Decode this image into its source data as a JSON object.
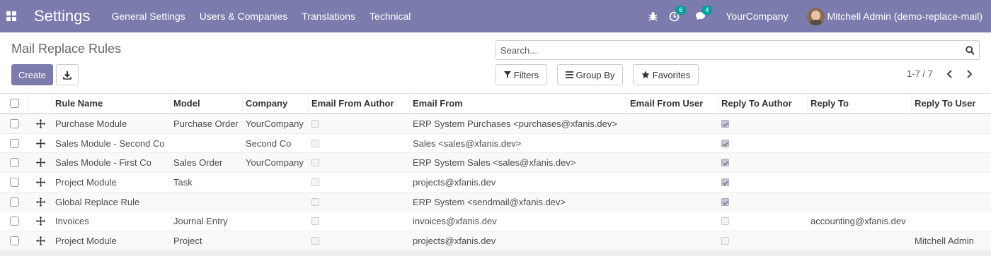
{
  "navbar": {
    "app_name": "Settings",
    "menu": [
      "General Settings",
      "Users & Companies",
      "Translations",
      "Technical"
    ],
    "activity_badge": "6",
    "messages_badge": "4",
    "company": "YourCompany",
    "user": "Mitchell Admin (demo-replace-mail)"
  },
  "control_panel": {
    "title": "Mail Replace Rules",
    "create_label": "Create",
    "search_placeholder": "Search...",
    "filters_label": "Filters",
    "group_by_label": "Group By",
    "favorites_label": "Favorites",
    "pager": "1-7 / 7"
  },
  "table": {
    "columns": [
      "Rule Name",
      "Model",
      "Company",
      "Email From Author",
      "Email From",
      "Email From User",
      "Reply To Author",
      "Reply To",
      "Reply To User"
    ],
    "rows": [
      {
        "name": "Purchase Module",
        "model": "Purchase Order",
        "company": "YourCompany",
        "email_from_author": false,
        "email_from": "ERP System Purchases <purchases@xfanis.dev>",
        "email_from_user": "",
        "reply_to_author": true,
        "reply_to": "",
        "reply_to_user": ""
      },
      {
        "name": "Sales Module - Second Co",
        "model": "",
        "company": "Second Co",
        "email_from_author": false,
        "email_from": "Sales <sales@xfanis.dev>",
        "email_from_user": "",
        "reply_to_author": true,
        "reply_to": "",
        "reply_to_user": ""
      },
      {
        "name": "Sales Module - First Co",
        "model": "Sales Order",
        "company": "YourCompany",
        "email_from_author": false,
        "email_from": "ERP System Sales <sales@xfanis.dev>",
        "email_from_user": "",
        "reply_to_author": true,
        "reply_to": "",
        "reply_to_user": ""
      },
      {
        "name": "Project Module",
        "model": "Task",
        "company": "",
        "email_from_author": false,
        "email_from": "projects@xfanis.dev",
        "email_from_user": "",
        "reply_to_author": true,
        "reply_to": "",
        "reply_to_user": ""
      },
      {
        "name": "Global Replace Rule",
        "model": "",
        "company": "",
        "email_from_author": false,
        "email_from": "ERP System <sendmail@xfanis.dev>",
        "email_from_user": "",
        "reply_to_author": true,
        "reply_to": "",
        "reply_to_user": ""
      },
      {
        "name": "Invoices",
        "model": "Journal Entry",
        "company": "",
        "email_from_author": false,
        "email_from": "invoices@xfanis.dev",
        "email_from_user": "",
        "reply_to_author": false,
        "reply_to": "accounting@xfanis.dev",
        "reply_to_user": ""
      },
      {
        "name": "Project Module",
        "model": "Project",
        "company": "",
        "email_from_author": false,
        "email_from": "projects@xfanis.dev",
        "email_from_user": "",
        "reply_to_author": false,
        "reply_to": "",
        "reply_to_user": "Mitchell Admin"
      }
    ]
  },
  "colors": {
    "brand": "#7c7bad",
    "badge": "#00a09d"
  }
}
